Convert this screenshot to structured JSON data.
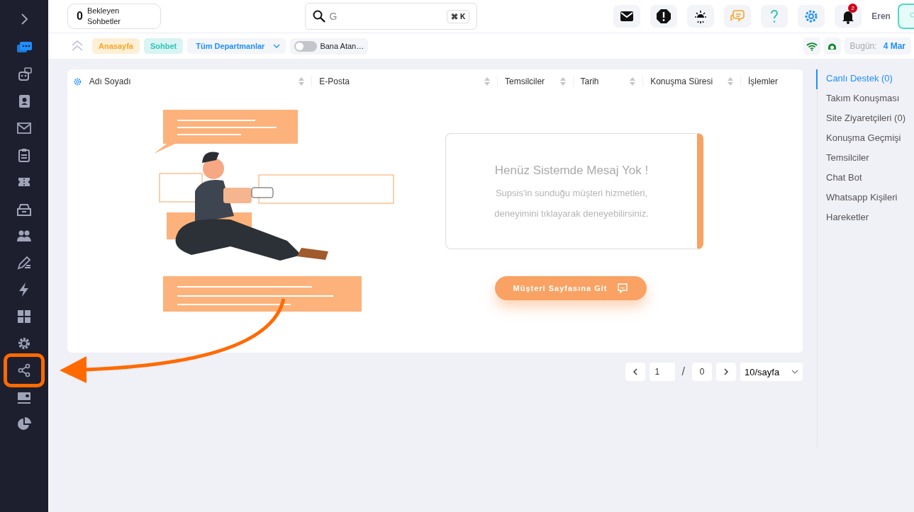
{
  "sidebar": {
    "items": [
      {
        "kind": "expand",
        "selected": false,
        "highlighted": false
      },
      {
        "kind": "chat",
        "selected": true,
        "highlighted": false
      },
      {
        "kind": "robot",
        "selected": false,
        "highlighted": false
      },
      {
        "kind": "contacts",
        "selected": false,
        "highlighted": false
      },
      {
        "kind": "mail",
        "selected": false,
        "highlighted": false
      },
      {
        "kind": "clipboard",
        "selected": false,
        "highlighted": false
      },
      {
        "kind": "ticket",
        "selected": false,
        "highlighted": false
      },
      {
        "kind": "inbox",
        "selected": false,
        "highlighted": false
      },
      {
        "kind": "people",
        "selected": false,
        "highlighted": false
      },
      {
        "kind": "pen",
        "selected": false,
        "highlighted": false
      },
      {
        "kind": "bolt",
        "selected": false,
        "highlighted": false
      },
      {
        "kind": "grid",
        "selected": false,
        "highlighted": false
      },
      {
        "kind": "gear",
        "selected": false,
        "highlighted": false
      },
      {
        "kind": "share",
        "selected": false,
        "highlighted": true
      },
      {
        "kind": "card",
        "selected": false,
        "highlighted": false
      },
      {
        "kind": "pie",
        "selected": false,
        "highlighted": false
      }
    ]
  },
  "header": {
    "waiting": {
      "count": "0",
      "label": "Bekleyen Sohbetler"
    },
    "search": {
      "value": "G",
      "shortcut": "⌘ K"
    },
    "icon_buttons": [
      {
        "kind": "mail"
      },
      {
        "kind": "alert"
      },
      {
        "kind": "bulb"
      },
      {
        "kind": "chat"
      },
      {
        "kind": "help"
      },
      {
        "kind": "settings"
      },
      {
        "kind": "bell",
        "badge": "2"
      }
    ],
    "user": {
      "name": "Eren"
    }
  },
  "toolbar": {
    "tags": [
      {
        "label": "Anasayfa",
        "color": "#f7a524"
      },
      {
        "label": "Sohbet",
        "color": "#2ec4b6"
      }
    ],
    "department": {
      "value": "Tüm Departmanlar"
    },
    "assigned_toggle": {
      "label": "Bana Atan…",
      "on": false
    },
    "date": {
      "label": "Bugün:",
      "value": "4 Mar"
    }
  },
  "table": {
    "columns": [
      {
        "label": "Adı Soyadı",
        "sortable": true
      },
      {
        "label": "E-Posta",
        "sortable": true
      },
      {
        "label": "Temsilciler",
        "sortable": true
      },
      {
        "label": "Tarih",
        "sortable": true
      },
      {
        "label": "Konuşma Süresi",
        "sortable": true
      },
      {
        "label": "İşlemler",
        "sortable": false
      }
    ]
  },
  "empty_state": {
    "title": "Henüz Sistemde Mesaj Yok !",
    "lines": [
      "Supsis'in sunduğu müşteri hizmetleri,",
      "deneyimini tıklayarak deneyebilirsiniz."
    ],
    "button": "Müşteri Sayfasına Git"
  },
  "pagination": {
    "page": "1",
    "separator": "/",
    "total": "0",
    "page_size": "10/sayfa"
  },
  "right_nav": {
    "items": [
      {
        "label": "Canlı Destek (0)",
        "selected": true
      },
      {
        "label": "Takım Konuşması",
        "selected": false
      },
      {
        "label": "Site Ziyaretçileri (0)",
        "selected": false
      },
      {
        "label": "Konuşma Geçmişi",
        "selected": false
      },
      {
        "label": "Temsilciler",
        "selected": false
      },
      {
        "label": "Chat Bot",
        "selected": false
      },
      {
        "label": "Whatsapp Kişileri",
        "selected": false
      },
      {
        "label": "Hareketler",
        "selected": false
      }
    ]
  }
}
